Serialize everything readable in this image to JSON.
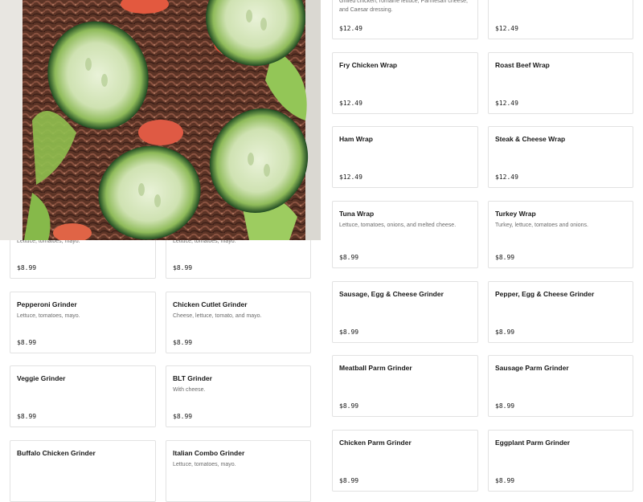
{
  "right_col1": [
    {
      "name": "",
      "desc": "Grilled chicken, romaine lettuce, Parmesan cheese, and Caesar dressing.",
      "price": "$12.49"
    },
    {
      "name": "Fry Chicken Wrap",
      "desc": "",
      "price": "$12.49"
    },
    {
      "name": "Ham Wrap",
      "desc": "",
      "price": "$12.49"
    },
    {
      "name": "Tuna Wrap",
      "desc": "Lettuce, tomatoes, onions, and melted cheese.",
      "price": "$8.99"
    },
    {
      "name": "Sausage, Egg & Cheese Grinder",
      "desc": "",
      "price": "$8.99"
    },
    {
      "name": "Meatball Parm Grinder",
      "desc": "",
      "price": "$8.99"
    },
    {
      "name": "Chicken Parm Grinder",
      "desc": "",
      "price": "$8.99"
    }
  ],
  "right_col2": [
    {
      "name": "",
      "desc": "",
      "price": "$12.49"
    },
    {
      "name": "Roast Beef Wrap",
      "desc": "",
      "price": "$12.49"
    },
    {
      "name": "Steak & Cheese Wrap",
      "desc": "",
      "price": "$12.49"
    },
    {
      "name": "Turkey Wrap",
      "desc": "Turkey, lettuce, tomatoes and onions.",
      "price": "$8.99"
    },
    {
      "name": "Pepper, Egg & Cheese Grinder",
      "desc": "",
      "price": "$8.99"
    },
    {
      "name": "Sausage Parm Grinder",
      "desc": "",
      "price": "$8.99"
    },
    {
      "name": "Eggplant Parm Grinder",
      "desc": "",
      "price": "$8.99"
    }
  ],
  "left_col1": [
    {
      "name": "",
      "desc": "Lettuce, tomatoes, mayo.",
      "price": "$8.99"
    },
    {
      "name": "Pepperoni Grinder",
      "desc": "Lettuce, tomatoes, mayo.",
      "price": "$8.99"
    },
    {
      "name": "Veggie Grinder",
      "desc": "",
      "price": "$8.99"
    },
    {
      "name": "Buffalo Chicken Grinder",
      "desc": "",
      "price": ""
    }
  ],
  "left_col2": [
    {
      "name": "",
      "desc": "Lettuce, tomatoes, mayo.",
      "price": "$8.99"
    },
    {
      "name": "Chicken Cutlet Grinder",
      "desc": "Cheese, lettuce, tomato, and mayo.",
      "price": "$8.99"
    },
    {
      "name": "BLT Grinder",
      "desc": "With cheese.",
      "price": "$8.99"
    },
    {
      "name": "Italian Combo Grinder",
      "desc": "Lettuce, tomatoes, mayo.",
      "price": ""
    }
  ],
  "photo": {
    "subject": "salad with cucumber slices, bacon and lettuce"
  }
}
